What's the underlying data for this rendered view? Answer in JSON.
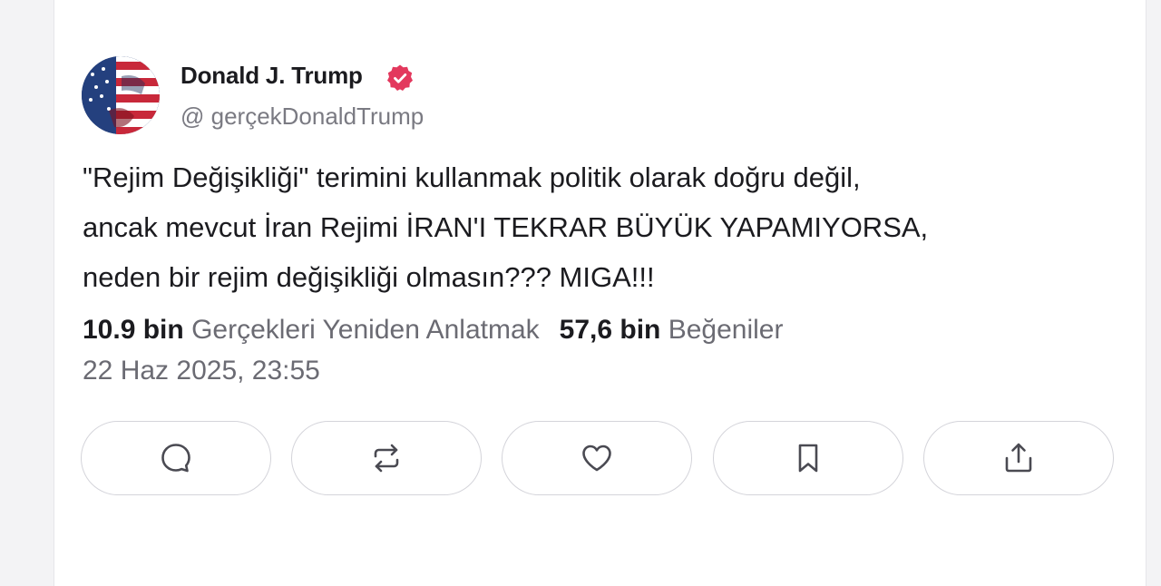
{
  "post": {
    "author": {
      "display_name": "Donald J. Trump",
      "handle": "@ gerçekDonaldTrump",
      "verified": true,
      "avatar_icon": "avatar-flag-portrait"
    },
    "text_lines": [
      "\"Rejim Değişikliği\" terimini kullanmak politik olarak doğru değil,",
      "ancak mevcut İran Rejimi İRAN'I TEKRAR BÜYÜK YAPAMIYORSA,",
      "neden bir rejim değişikliği olmasın??? MIGA!!!"
    ],
    "stats": {
      "retruths_count": "10.9 bin",
      "retruths_label": "Gerçekleri Yeniden Anlatmak",
      "likes_count": "57,6 bin",
      "likes_label": "Beğeniler"
    },
    "timestamp": "22 Haz 2025, 23:55"
  },
  "actions": [
    {
      "name": "reply",
      "icon": "comment-icon"
    },
    {
      "name": "retruth",
      "icon": "repost-icon"
    },
    {
      "name": "like",
      "icon": "heart-icon"
    },
    {
      "name": "bookmark",
      "icon": "bookmark-icon"
    },
    {
      "name": "share",
      "icon": "share-icon"
    }
  ],
  "colors": {
    "verified_badge": "#e3385d",
    "text_primary": "#1b1b1f",
    "text_secondary": "#6b6b73",
    "border": "#d4d4da"
  }
}
